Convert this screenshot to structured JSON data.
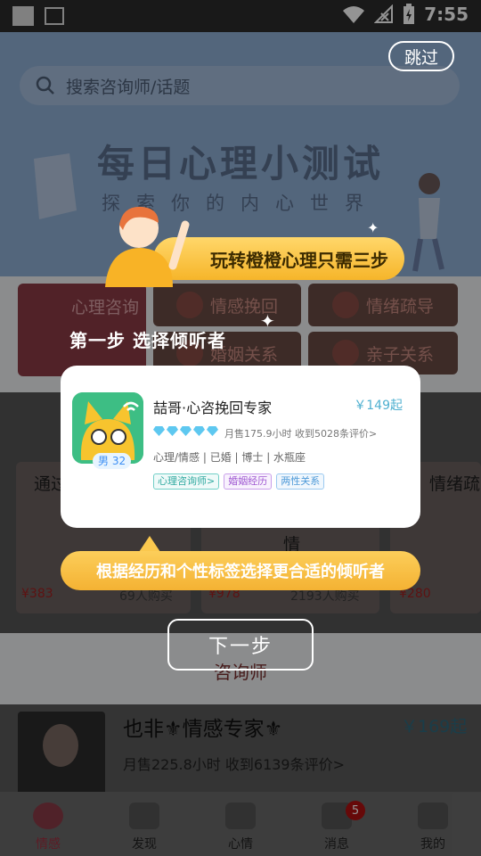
{
  "status_bar": {
    "time": "7:55"
  },
  "search": {
    "placeholder": "搜索咨询师/话题"
  },
  "skip_label": "跳过",
  "banner": {
    "title": "每日心理小测试",
    "subtitle": "探索你的内心世界"
  },
  "categories": {
    "feature": "心理咨询",
    "items": [
      "情感挽回",
      "情绪疏导",
      "婚姻关系",
      "亲子关系"
    ]
  },
  "cards": {
    "left_title": "通过",
    "right_title": "情绪疏",
    "middle_title": "情",
    "prices": [
      "¥383",
      "¥978",
      "¥280"
    ],
    "sold": [
      "69人购买",
      "2193人购买"
    ]
  },
  "advisor_section_title": "咨询师",
  "advisor": {
    "name": "也非⚜情感专家⚜",
    "price": "￥169起",
    "stats": "月售225.8小时   收到6139条评价>"
  },
  "tabs": [
    {
      "label": "情感",
      "icon": "tulip-icon",
      "active": true
    },
    {
      "label": "发现",
      "icon": "diamond-icon"
    },
    {
      "label": "心情",
      "icon": "chat-icon"
    },
    {
      "label": "消息",
      "icon": "mail-icon",
      "badge": "5"
    },
    {
      "label": "我的",
      "icon": "home-icon"
    }
  ],
  "guide": {
    "banner_text": "玩转橙橙心理只需三步",
    "step_label": "第一步  选择倾听者",
    "card": {
      "name": "喆哥·心咨挽回专家",
      "price": "￥149起",
      "gender_age": "男 32",
      "stats": "月售175.9小时   收到5028条评价>",
      "tags_line": "心理/情感 | 已婚 | 博士 | 水瓶座",
      "chips": [
        "心理咨询师>",
        "婚姻经历",
        "两性关系"
      ]
    },
    "tip": "根据经历和个性标签选择更合适的倾听者",
    "next_label": "下一步"
  },
  "colors": {
    "accent": "#f6b52a",
    "price_blue": "#4fb0d0",
    "diamond": "#5ec8f0"
  }
}
